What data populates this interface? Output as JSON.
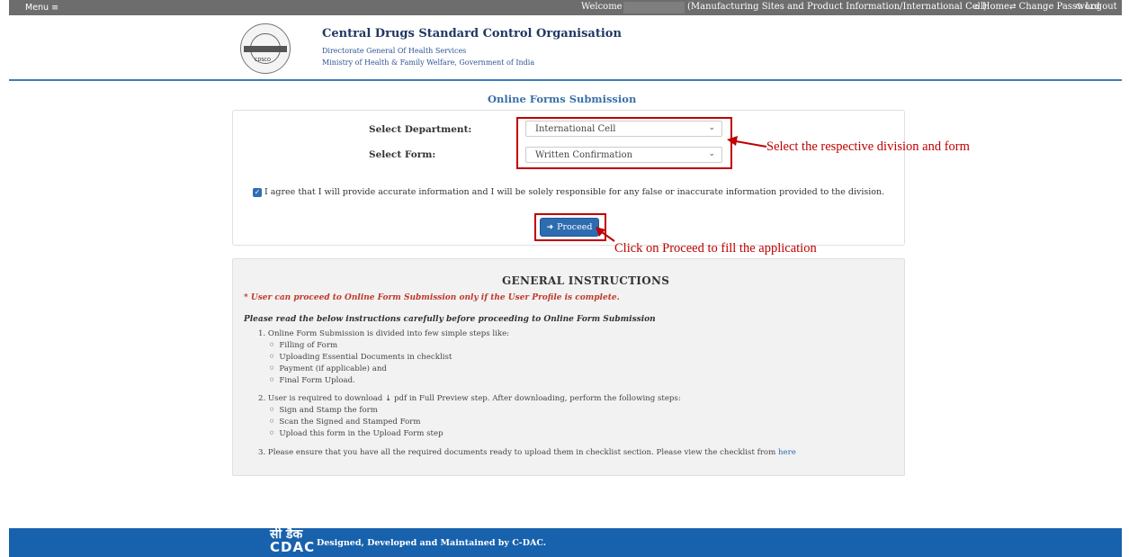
{
  "topbar": {
    "menu_label": "Menu ≡",
    "welcome": "Welcome Mr.",
    "cell_info": "(Manufacturing Sites and Product Information/International Cell)",
    "home": "Home",
    "change_password": "Change Password",
    "logout": "Logout",
    "home_icon": "⌂",
    "change_password_icon": "⇄",
    "logout_icon": "⏻"
  },
  "header": {
    "title": "Central Drugs Standard Control Organisation",
    "subtitle1": "Directorate General Of Health Services",
    "subtitle2": "Ministry of Health & Family Welfare, Government of India",
    "emblem_text": "CDSCO"
  },
  "form": {
    "section_title": "Online Forms Submission",
    "department_label": "Select Department:",
    "department_value": "International Cell",
    "form_label": "Select Form:",
    "form_value": "Written Confirmation",
    "agree_text": "I agree that I will provide accurate information and I will be solely responsible for any false or inaccurate information provided to the division.",
    "proceed_label": "Proceed",
    "proceed_icon": "➜"
  },
  "annotations": {
    "select_note": "Select the respective division and form",
    "proceed_note": "Click on Proceed to fill the application"
  },
  "instructions": {
    "title": "GENERAL INSTRUCTIONS",
    "note": "* User can proceed to Online Form Submission only if the User Profile is complete.",
    "intro": "Please read the below instructions carefully before proceeding to Online Form Submission",
    "item1": "1. Online Form Submission is divided into few simple steps like:",
    "item1_bullets": [
      "Filling of Form",
      "Uploading Essential Documents in checklist",
      "Payment (if applicable) and",
      "Final Form Upload."
    ],
    "item2": "2. User is required to download ⤓ pdf in Full Preview step. After downloading, perform the following steps:",
    "item2_bullets": [
      "Sign and Stamp the form",
      "Scan the Signed and Stamped Form",
      "Upload this form in the Upload Form step"
    ],
    "item3": "3. Please ensure that you have all the required documents ready to upload them in checklist section. Please view the checklist from",
    "item3_link": "here"
  },
  "footer": {
    "logo_line1": "सी डैक",
    "logo_line2": "CDAC",
    "text": "Designed, Developed and Maintained by C-DAC."
  },
  "colors": {
    "topbar": "#6d6d6d",
    "brand_blue": "#2e6cb2",
    "footer": "#1862ad",
    "annotation_red": "#c00000"
  }
}
